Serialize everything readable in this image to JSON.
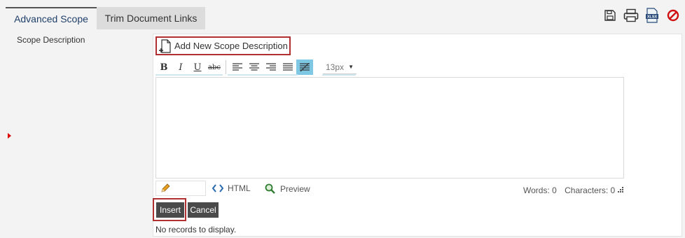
{
  "tabs": [
    {
      "label": "Advanced Scope"
    },
    {
      "label": "Trim Document Links"
    }
  ],
  "icons": {
    "save": "save-icon",
    "print": "print-icon",
    "excel": "xlsx-export-icon",
    "cancel": "cancel-icon",
    "excel_text": "XLSX"
  },
  "field": {
    "label": "Scope Description"
  },
  "add_button": {
    "label": "Add New Scope Description"
  },
  "editor": {
    "toolbar": {
      "bold": "B",
      "italic": "I",
      "underline": "U",
      "strike": "abc",
      "font_size": "13px"
    },
    "modes": {
      "html": "HTML",
      "preview": "Preview"
    },
    "words": "Words: 0",
    "characters": "Characters: 0"
  },
  "actions": {
    "insert": "Insert",
    "cancel": "Cancel"
  },
  "status": {
    "no_records": "No records to display."
  },
  "colors": {
    "accent_red": "#b03030",
    "selected_tool": "#7ec8e3",
    "dark_button": "#4a4a4a"
  }
}
